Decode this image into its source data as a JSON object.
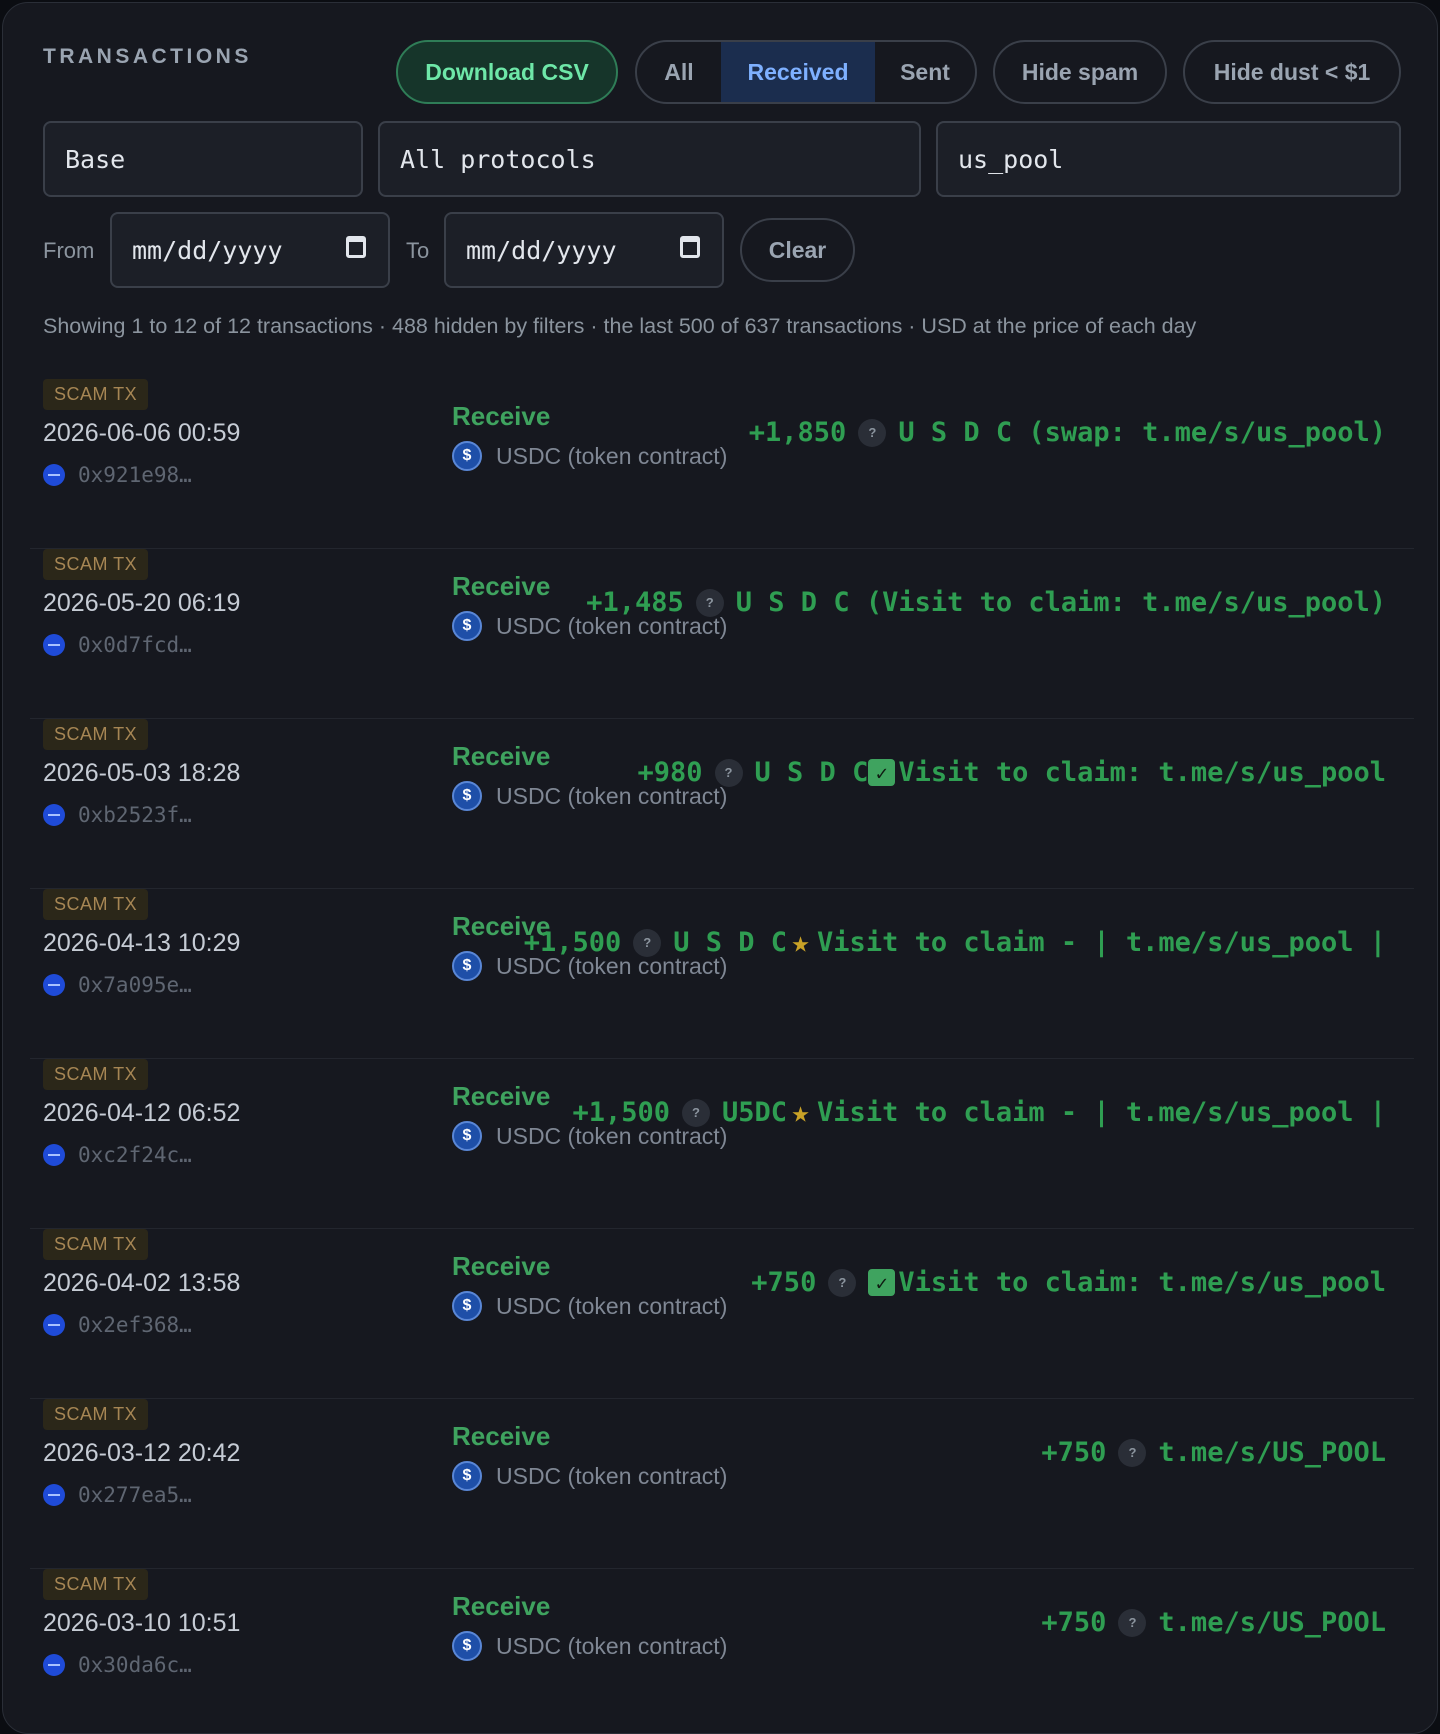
{
  "header": {
    "title": "TRANSACTIONS"
  },
  "toolbar": {
    "download_csv": "Download CSV",
    "filter_all": "All",
    "filter_received": "Received",
    "filter_sent": "Sent",
    "hide_spam": "Hide spam",
    "hide_dust": "Hide dust < $1",
    "active_filter": "Received"
  },
  "filters": {
    "chain": "Base",
    "protocol": "All protocols",
    "search": "us_pool",
    "from_label": "From",
    "to_label": "To",
    "from_value": "mm/dd/yyyy",
    "to_value": "mm/dd/yyyy",
    "clear": "Clear"
  },
  "summary": "Showing 1 to 12 of 12 transactions · 488 hidden by filters · the last 500 of 637 transactions · USD at the price of each day",
  "colors": {
    "accent_green": "#2f9e52",
    "badge": "#a68654",
    "selected_tab": "#7eb0ff"
  },
  "transactions": [
    {
      "badge": "SCAM TX",
      "time": "2026-06-06 00:59",
      "address": "0x921e98…",
      "type": "Receive",
      "token": "USDC (token contract)",
      "amount": "+1,850",
      "symbol": "U S D C (swap: t.me/s/us_pool)",
      "symbol_icon": ""
    },
    {
      "badge": "SCAM TX",
      "time": "2026-05-20 06:19",
      "address": "0x0d7fcd…",
      "type": "Receive",
      "token": "USDC (token contract)",
      "amount": "+1,485",
      "symbol": "U S D C (Visit to claim: t.me/s/us_pool)",
      "symbol_icon": ""
    },
    {
      "badge": "SCAM TX",
      "time": "2026-05-03 18:28",
      "address": "0xb2523f…",
      "type": "Receive",
      "token": "USDC (token contract)",
      "amount": "+980",
      "symbol_prefix": "U S D C ",
      "symbol": "Visit to claim: t.me/s/us_pool",
      "symbol_icon": "check-icon"
    },
    {
      "badge": "SCAM TX",
      "time": "2026-04-13 10:29",
      "address": "0x7a095e…",
      "type": "Receive",
      "token": "USDC (token contract)",
      "amount": "+1,500",
      "symbol_prefix": "U S D C ",
      "symbol": "Visit to claim - | t.me/s/us_pool |",
      "symbol_icon": "star-icon"
    },
    {
      "badge": "SCAM TX",
      "time": "2026-04-12 06:52",
      "address": "0xc2f24c…",
      "type": "Receive",
      "token": "USDC (token contract)",
      "amount": "+1,500",
      "symbol_prefix": "U5DC ",
      "symbol": "Visit to claim - | t.me/s/us_pool |",
      "symbol_icon": "star-icon"
    },
    {
      "badge": "SCAM TX",
      "time": "2026-04-02 13:58",
      "address": "0x2ef368…",
      "type": "Receive",
      "token": "USDC (token contract)",
      "amount": "+750",
      "symbol": "Visit to claim: t.me/s/us_pool",
      "symbol_icon": "check-icon"
    },
    {
      "badge": "SCAM TX",
      "time": "2026-03-12 20:42",
      "address": "0x277ea5…",
      "type": "Receive",
      "token": "USDC (token contract)",
      "amount": "+750",
      "symbol": "t.me/s/US_POOL",
      "symbol_icon": ""
    },
    {
      "badge": "SCAM TX",
      "time": "2026-03-10 10:51",
      "address": "0x30da6c…",
      "type": "Receive",
      "token": "USDC (token contract)",
      "amount": "+750",
      "symbol": "t.me/s/US_POOL",
      "symbol_icon": ""
    }
  ]
}
